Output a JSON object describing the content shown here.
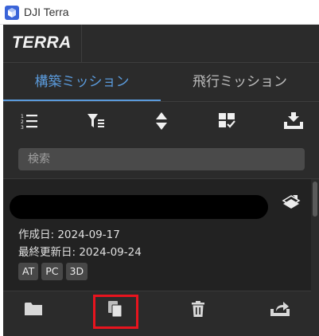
{
  "titlebar": {
    "title": "DJI Terra",
    "icon": "dji-terra-cube-icon"
  },
  "logo": {
    "text": "TERRA"
  },
  "tabs": [
    {
      "label": "構築ミッション",
      "active": true
    },
    {
      "label": "飛行ミッション",
      "active": false
    }
  ],
  "toolbar": {
    "icons": [
      "numbered-list-icon",
      "filter-list-icon",
      "sort-icon",
      "select-grid-icon",
      "import-icon"
    ]
  },
  "search": {
    "placeholder": "検索"
  },
  "mission": {
    "created": "作成日: 2024-09-17",
    "updated": "最終更新日: 2024-09-24",
    "tags": [
      "AT",
      "PC",
      "3D"
    ],
    "type_icon": "map-layers-icon"
  },
  "card_actions": {
    "icons": [
      "folder-icon",
      "copy-icon",
      "trash-icon",
      "export-icon"
    ],
    "highlighted": "copy-icon"
  },
  "colors": {
    "accent": "#5b9bdc",
    "panel_bg": "#2b2b2b",
    "card_bg": "#222222",
    "highlight": "#e8141e"
  }
}
